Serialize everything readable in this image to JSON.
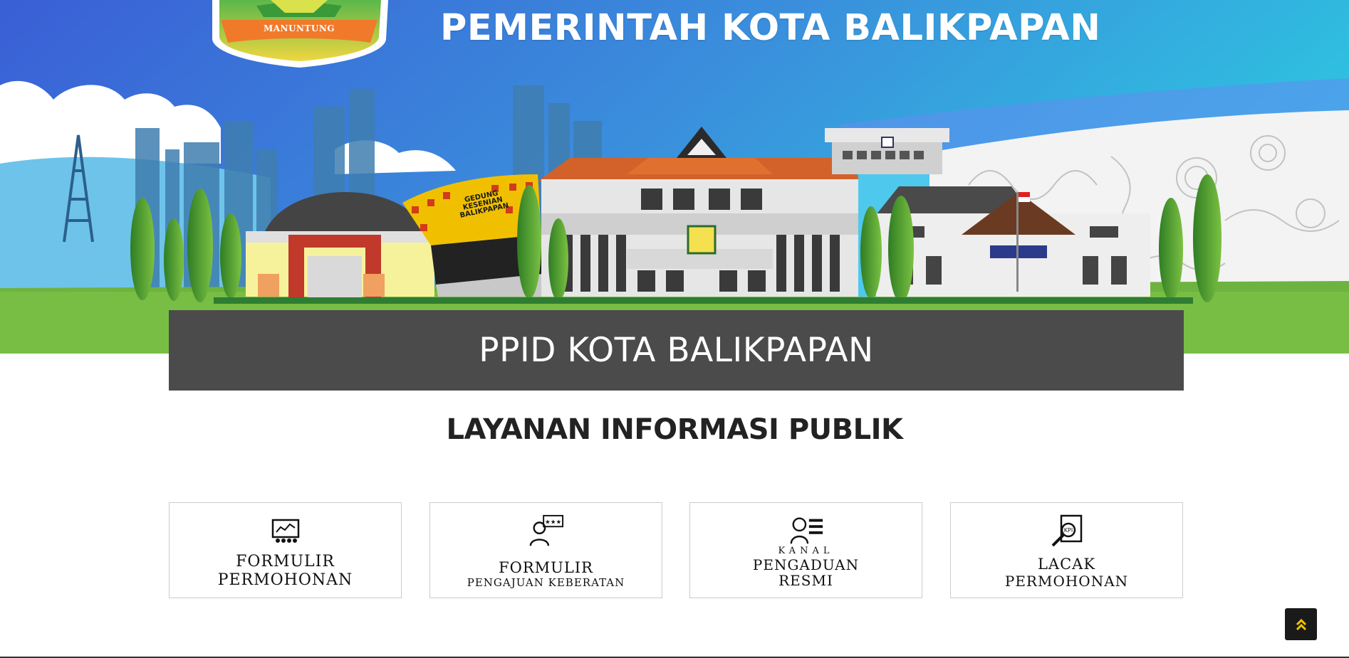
{
  "banner": {
    "title": "PEMERINTAH KOTA BALIKPAPAN",
    "crest_ribbon": "MANUNTUNG",
    "building_sign": "GEDUNG KESENIAN BALIKPAPAN"
  },
  "title_bar": {
    "text": "PPID KOTA BALIKPAPAN"
  },
  "section": {
    "heading": "LAYANAN INFORMASI PUBLIK"
  },
  "cards": [
    {
      "icon": "presentation-board-icon",
      "line1": "FORMULIR",
      "line2": "PERMOHONAN"
    },
    {
      "icon": "person-rating-icon",
      "line1": "FORMULIR",
      "line2": "PENGAJUAN KEBERATAN"
    },
    {
      "icon": "person-list-icon",
      "line1": "KANAL",
      "line2": "PENGADUAN",
      "line3": "RESMI"
    },
    {
      "icon": "kpi-search-icon",
      "line1": "LACAK",
      "line2": "PERMOHONAN"
    }
  ],
  "scroll_top": {
    "icon": "double-chevron-up-icon"
  },
  "colors": {
    "sky_left": "#3b62d8",
    "sky_right": "#2ec0e0",
    "title_bar": "#4b4b4b",
    "grass": "#6db33f",
    "scroll_button": "#1a1a1a",
    "scroll_icon": "#f2c200"
  }
}
